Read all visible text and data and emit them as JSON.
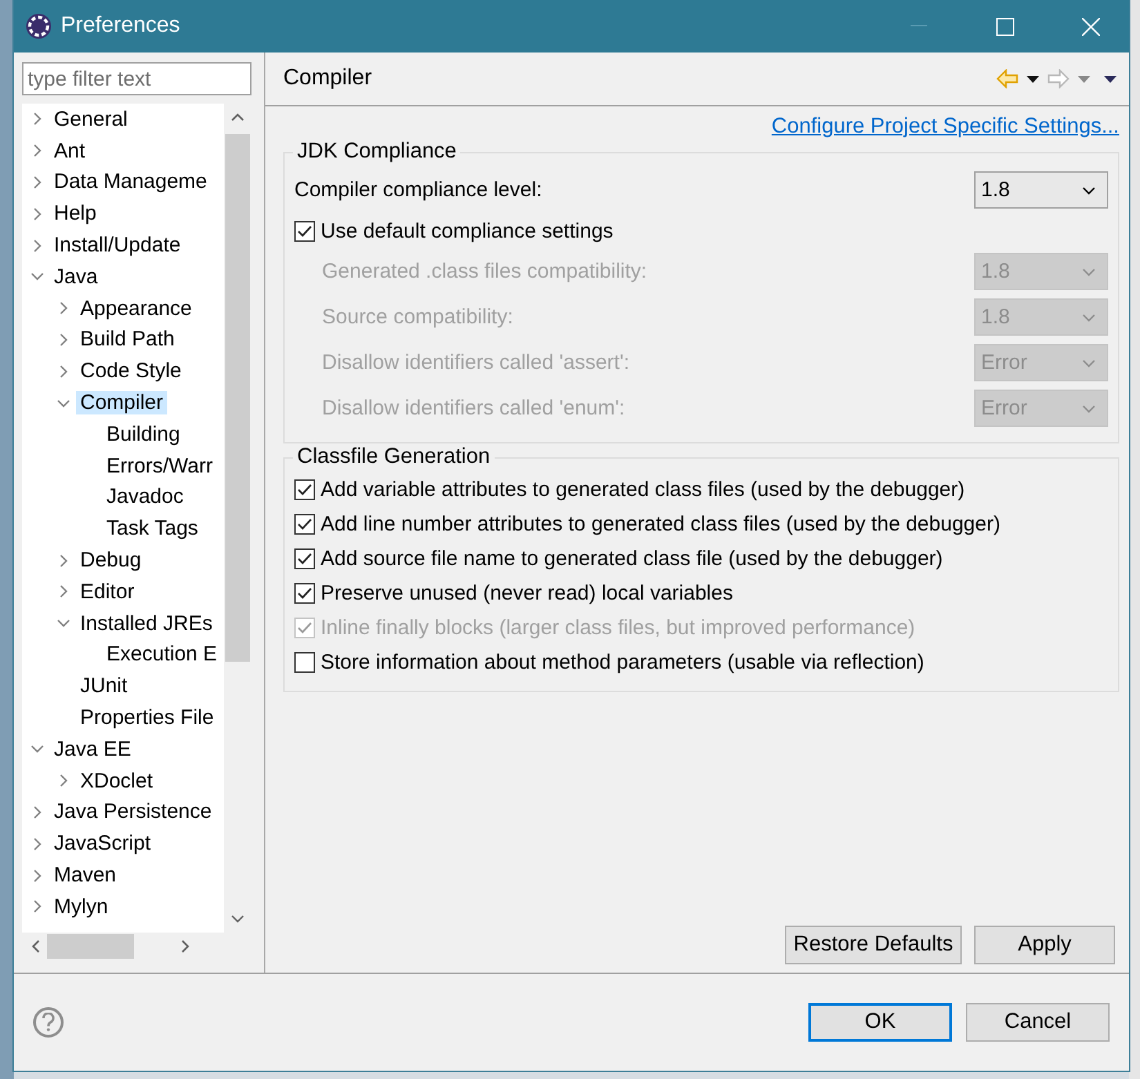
{
  "window": {
    "title": "Preferences"
  },
  "filter": {
    "placeholder": "type filter text"
  },
  "tree": [
    {
      "label": "General",
      "expanded": false,
      "selected": false
    },
    {
      "label": "Ant",
      "expanded": false,
      "selected": false
    },
    {
      "label": "Data Manageme",
      "expanded": false,
      "selected": false
    },
    {
      "label": "Help",
      "expanded": false,
      "selected": false
    },
    {
      "label": "Install/Update",
      "expanded": false,
      "selected": false
    },
    {
      "label": "Java",
      "expanded": true,
      "selected": false,
      "children": [
        {
          "label": "Appearance",
          "expanded": false,
          "selected": false
        },
        {
          "label": "Build Path",
          "expanded": false,
          "selected": false
        },
        {
          "label": "Code Style",
          "expanded": false,
          "selected": false
        },
        {
          "label": "Compiler",
          "expanded": true,
          "selected": true,
          "children": [
            {
              "label": "Building",
              "selected": false
            },
            {
              "label": "Errors/Warr",
              "selected": false
            },
            {
              "label": "Javadoc",
              "selected": false
            },
            {
              "label": "Task Tags",
              "selected": false
            }
          ]
        },
        {
          "label": "Debug",
          "expanded": false,
          "selected": false
        },
        {
          "label": "Editor",
          "expanded": false,
          "selected": false
        },
        {
          "label": "Installed JREs",
          "expanded": true,
          "selected": false,
          "children": [
            {
              "label": "Execution E",
              "selected": false
            }
          ]
        },
        {
          "label": "JUnit",
          "selected": false
        },
        {
          "label": "Properties File",
          "selected": false
        }
      ]
    },
    {
      "label": "Java EE",
      "expanded": true,
      "selected": false,
      "children": [
        {
          "label": "XDoclet",
          "expanded": false,
          "selected": false
        }
      ]
    },
    {
      "label": "Java Persistence",
      "expanded": false,
      "selected": false
    },
    {
      "label": "JavaScript",
      "expanded": false,
      "selected": false
    },
    {
      "label": "Maven",
      "expanded": false,
      "selected": false
    },
    {
      "label": "Mylyn",
      "expanded": false,
      "selected": false
    }
  ],
  "page": {
    "title": "Compiler",
    "link": "Configure Project Specific Settings..."
  },
  "jdk_compliance": {
    "title": "JDK Compliance",
    "rows": [
      {
        "kind": "combo",
        "label": "Compiler compliance level:",
        "value": "1.8",
        "disabled": false
      },
      {
        "kind": "checkbox",
        "label": "Use default compliance settings",
        "checked": true,
        "disabled": false
      },
      {
        "kind": "combo",
        "label": "Generated .class files compatibility:",
        "value": "1.8",
        "disabled": true
      },
      {
        "kind": "combo",
        "label": "Source compatibility:",
        "value": "1.8",
        "disabled": true
      },
      {
        "kind": "combo",
        "label": "Disallow identifiers called 'assert':",
        "value": "Error",
        "disabled": true
      },
      {
        "kind": "combo",
        "label": "Disallow identifiers called 'enum':",
        "value": "Error",
        "disabled": true
      }
    ]
  },
  "classfile_generation": {
    "title": "Classfile Generation",
    "options": [
      {
        "label": "Add variable attributes to generated class files (used by the debugger)",
        "checked": true,
        "disabled": false
      },
      {
        "label": "Add line number attributes to generated class files (used by the debugger)",
        "checked": true,
        "disabled": false
      },
      {
        "label": "Add source file name to generated class file (used by the debugger)",
        "checked": true,
        "disabled": false
      },
      {
        "label": "Preserve unused (never read) local variables",
        "checked": true,
        "disabled": false
      },
      {
        "label": "Inline finally blocks (larger class files, but improved performance)",
        "checked": true,
        "disabled": true
      },
      {
        "label": "Store information about method parameters (usable via reflection)",
        "checked": false,
        "disabled": false
      }
    ]
  },
  "page_buttons": [
    "Restore Defaults",
    "Apply"
  ],
  "dialog_buttons": [
    {
      "label": "OK",
      "default": true
    },
    {
      "label": "Cancel",
      "default": false
    }
  ]
}
